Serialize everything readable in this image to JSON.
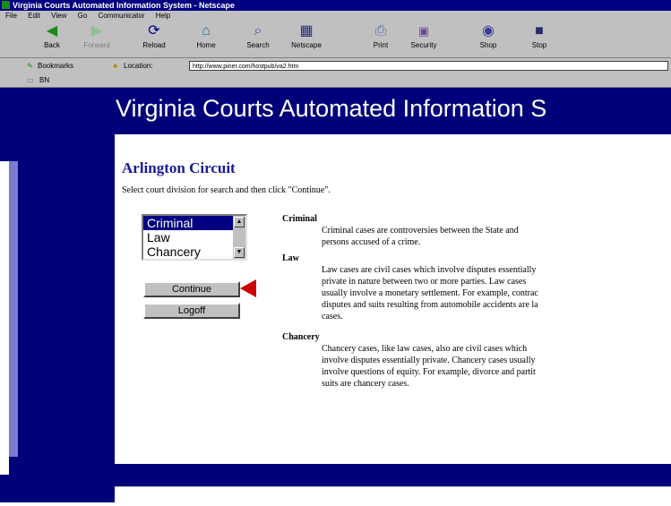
{
  "window": {
    "title": "Virginia Courts Automated Information System - Netscape"
  },
  "menu": [
    "File",
    "Edit",
    "View",
    "Go",
    "Communicator",
    "Help"
  ],
  "toolbar": [
    {
      "label": "Back",
      "icon": "back-arrow-icon",
      "glyph": "◀",
      "disabled": false
    },
    {
      "label": "Forward",
      "icon": "forward-arrow-icon",
      "glyph": "▶",
      "disabled": true
    },
    {
      "label": "Reload",
      "icon": "reload-icon",
      "glyph": "⟳",
      "disabled": false
    },
    {
      "label": "Home",
      "icon": "home-icon",
      "glyph": "⌂",
      "disabled": false
    },
    {
      "label": "Search",
      "icon": "search-icon",
      "glyph": "⌕",
      "disabled": false
    },
    {
      "label": "Netscape",
      "icon": "netscape-icon",
      "glyph": "▦",
      "disabled": false
    },
    {
      "label": "Print",
      "icon": "print-icon",
      "glyph": "⎙",
      "disabled": false
    },
    {
      "label": "Security",
      "icon": "lock-icon",
      "glyph": "🔒",
      "disabled": false
    },
    {
      "label": "Shop",
      "icon": "shop-icon",
      "glyph": "◉",
      "disabled": false
    },
    {
      "label": "Stop",
      "icon": "stop-icon",
      "glyph": "■",
      "disabled": false
    }
  ],
  "location": {
    "bookmarks_label": "Bookmarks",
    "location_label": "Location:",
    "url": "http://www.piner.com/hostpub/va2.htm"
  },
  "personal_bar": {
    "item": "BN"
  },
  "page": {
    "banner_title": "Virginia Courts Automated Information S",
    "heading": "Arlington Circuit",
    "instruction": "Select court division for search and then click \"Continue\".",
    "division_options": [
      "Criminal",
      "Law",
      "Chancery"
    ],
    "selected_division": "Criminal",
    "continue_label": "Continue",
    "logoff_label": "Logoff",
    "criminal_term": "Criminal",
    "criminal_lines": [
      "Criminal cases are controversies between the State and",
      "persons accused of a crime."
    ],
    "law_term": "Law",
    "law_lines": [
      "Law cases are civil cases which involve disputes essentially",
      "private in nature between two or more parties. Law cases",
      "usually involve a monetary settlement. For example, contrac",
      "disputes and suits resulting from automobile accidents are la",
      "cases."
    ],
    "chancery_term": "Chancery",
    "chancery_lines": [
      "Chancery cases, like law cases, also are civil cases which",
      "involve disputes essentially private. Chancery cases usually",
      "involve questions of equity. For example, divorce and partit",
      "suits are chancery cases."
    ]
  },
  "colors": {
    "navy": "#00007a",
    "pillar_highlight": "#7b7bd0",
    "heading": "#1a1a9a",
    "arrow": "#cc0000",
    "chrome": "#c0c0c0"
  }
}
